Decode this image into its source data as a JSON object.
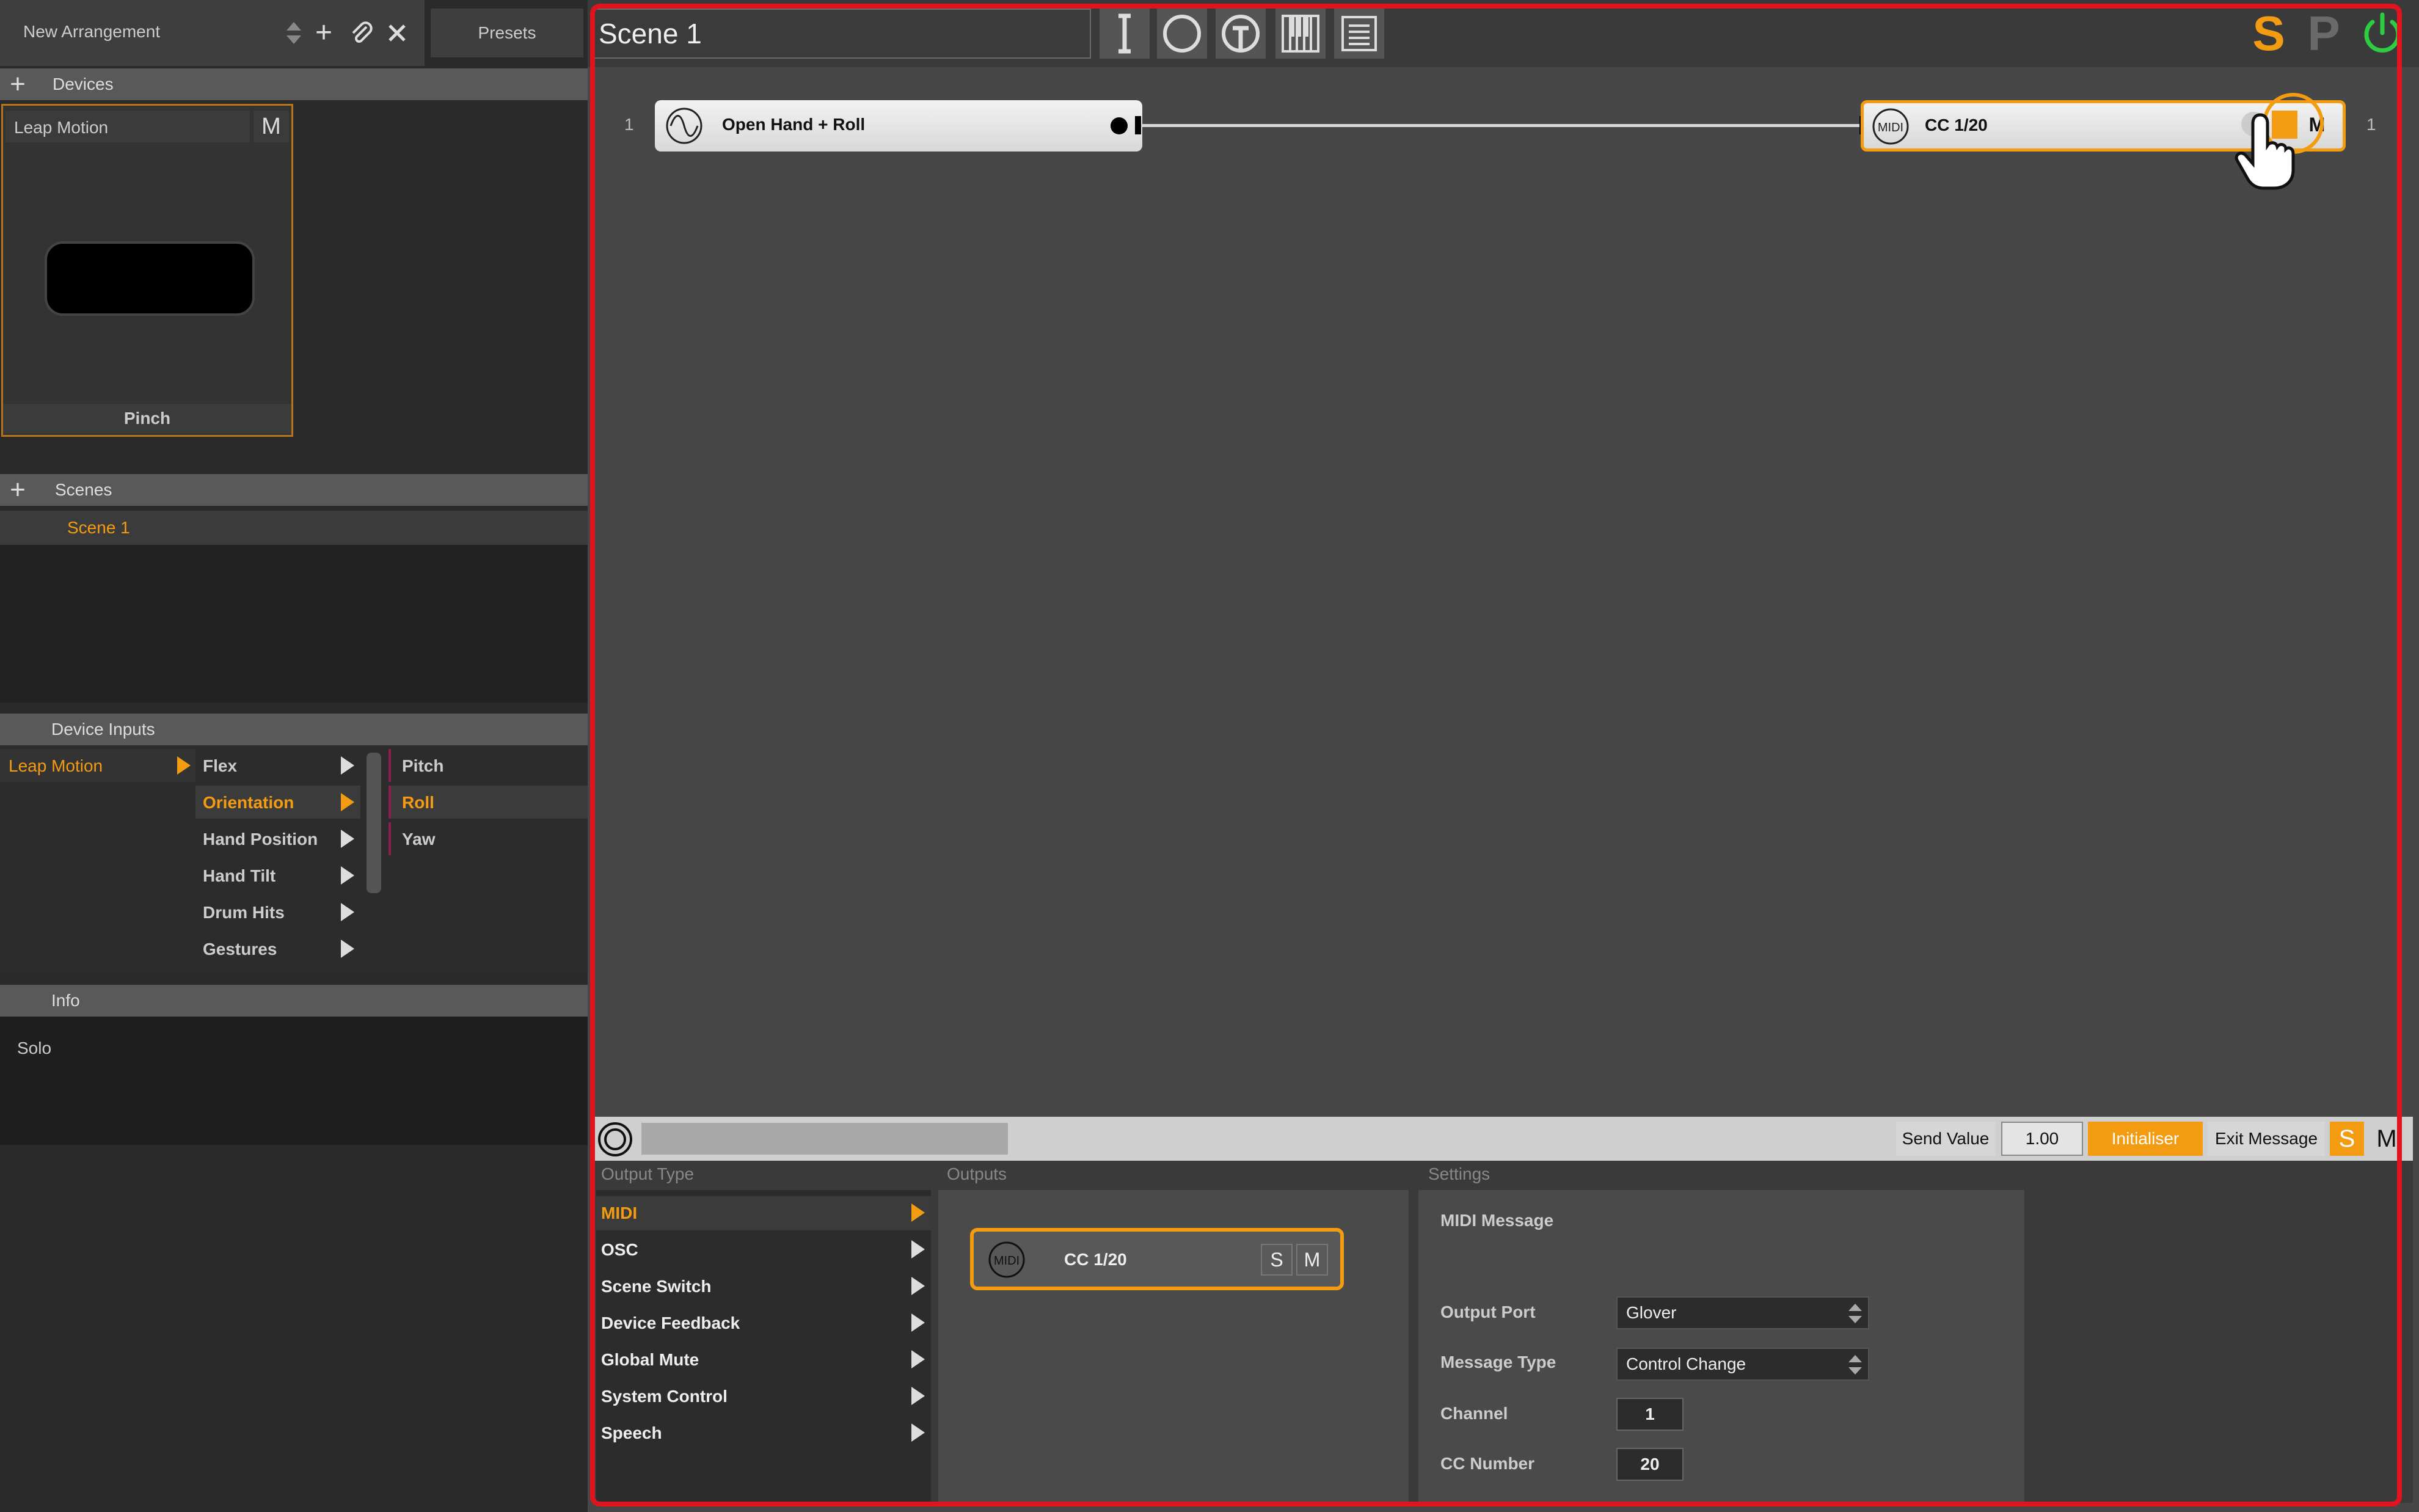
{
  "top_left": {
    "arrangement_name": "New Arrangement",
    "presets_label": "Presets"
  },
  "devices": {
    "header": "Devices",
    "device_name": "Leap Motion",
    "mute_label": "M",
    "gesture_label": "Pinch"
  },
  "scenes": {
    "header": "Scenes",
    "items": [
      "Scene 1"
    ]
  },
  "device_inputs": {
    "header": "Device Inputs",
    "col1": [
      "Leap Motion"
    ],
    "col2": [
      "Flex",
      "Orientation",
      "Hand Position",
      "Hand Tilt",
      "Drum Hits",
      "Gestures"
    ],
    "col3": [
      "Pitch",
      "Roll",
      "Yaw"
    ]
  },
  "info": {
    "header": "Info",
    "text": "Solo"
  },
  "scene_editor": {
    "scene_name": "Scene 1",
    "right_buttons": {
      "solo": "S",
      "pause": "P"
    },
    "row_number_left": "1",
    "row_number_right": "1",
    "input_block_label": "Open Hand + Roll",
    "output_block_label": "CC 1/20",
    "output_block_mute": "M"
  },
  "bottom_bar": {
    "send_value_label": "Send Value",
    "send_value": "1.00",
    "initialiser_label": "Initialiser",
    "exit_message_label": "Exit Message",
    "solo": "S",
    "mute": "M"
  },
  "output_type": {
    "header": "Output Type",
    "items": [
      "MIDI",
      "OSC",
      "Scene Switch",
      "Device Feedback",
      "Global Mute",
      "System Control",
      "Speech"
    ]
  },
  "outputs": {
    "header": "Outputs",
    "card_label": "CC 1/20",
    "midi_badge": "MIDI",
    "solo": "S",
    "mute": "M"
  },
  "settings": {
    "header": "Settings",
    "section_title": "MIDI Message",
    "output_port_label": "Output Port",
    "output_port_value": "Glover",
    "message_type_label": "Message Type",
    "message_type_value": "Control Change",
    "channel_label": "Channel",
    "channel_value": "1",
    "cc_number_label": "CC Number",
    "cc_number_value": "20"
  },
  "colors": {
    "accent": "#f39c12",
    "power": "#2ecc40",
    "highlight_border": "#e0141e"
  }
}
